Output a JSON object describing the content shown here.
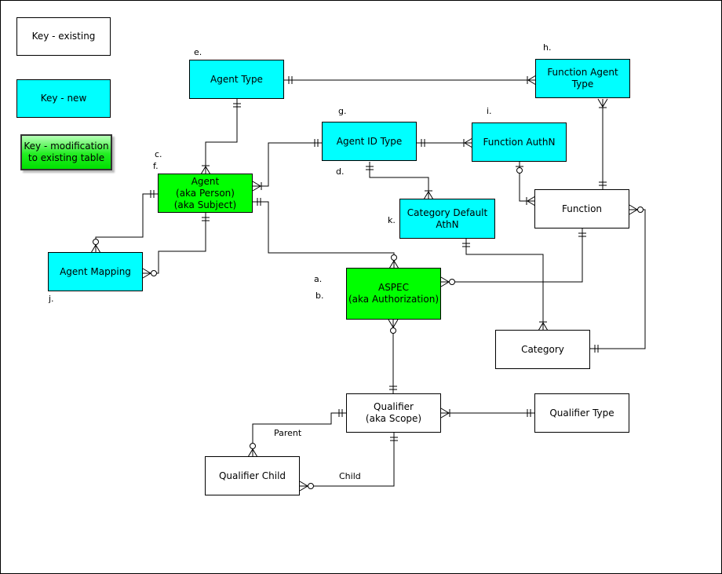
{
  "colors": {
    "existing": "#ffffff",
    "new": "#00ffff",
    "modified": "#00ff00",
    "line": "#000000"
  },
  "key": {
    "existing": "Key - existing",
    "new": "Key - new",
    "modified": "Key - modification\nto existing table"
  },
  "entities": {
    "agent_type": "Agent Type",
    "function_agent_type": "Function Agent Type",
    "agent_id_type": "Agent ID Type",
    "function_authn": "Function AuthN",
    "agent": "Agent\n(aka Person)\n(aka Subject)",
    "function": "Function",
    "category_default_athn": "Category Default\nAthN",
    "agent_mapping": "Agent Mapping",
    "aspec": "ASPEC\n(aka Authorization)",
    "category": "Category",
    "qualifier": "Qualifier\n(aka Scope)",
    "qualifier_type": "Qualifier Type",
    "qualifier_child": "Qualifier Child"
  },
  "annotations": {
    "a": "a.",
    "b": "b.",
    "c": "c.",
    "d": "d.",
    "e": "e.",
    "f": "f.",
    "g": "g.",
    "h": "h.",
    "i": "i.",
    "j": "j.",
    "k": "k."
  },
  "relationship_labels": {
    "parent": "Parent",
    "child": "Child"
  }
}
